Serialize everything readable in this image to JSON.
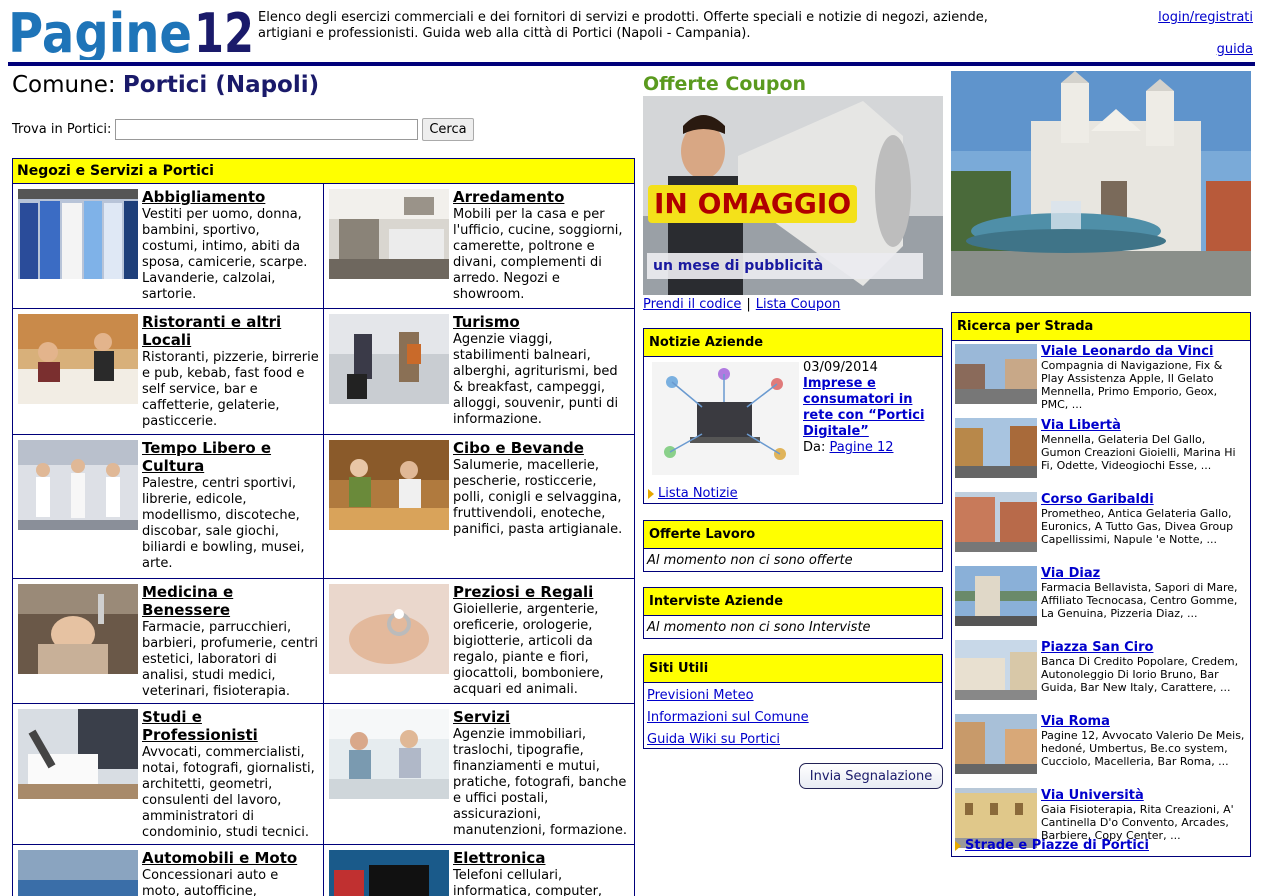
{
  "header": {
    "logo_text": "Pagine12",
    "tagline": "Elenco degli esercizi commerciali e dei fornitori di servizi e prodotti. Offerte speciali e notizie di negozi, aziende, artigiani e professionisti. Guida web alla città di Portici (Napoli - Campania).",
    "login_label": "login/registrati",
    "guide_label": "guida"
  },
  "comune": {
    "label": "Comune:",
    "name": "Portici (Napoli)"
  },
  "search": {
    "label": "Trova in Portici:",
    "value": "",
    "button": "Cerca"
  },
  "categories": {
    "title": "Negozi e Servizi a Portici",
    "items": [
      {
        "title": "Abbigliamento",
        "desc": "Vestiti per uomo, donna, bambini, sportivo, costumi, intimo, abiti da sposa, camicerie, scarpe. Lavanderie, calzolai, sartorie."
      },
      {
        "title": "Arredamento",
        "desc": "Mobili per la casa e per l'ufficio, cucine, soggiorni, camerette, poltrone e divani, complementi di arredo. Negozi e showroom."
      },
      {
        "title": "Ristoranti e altri Locali",
        "desc": "Ristoranti, pizzerie, birrerie e pub, kebab, fast food e self service, bar e caffetterie, gelaterie, pasticcerie."
      },
      {
        "title": "Turismo",
        "desc": "Agenzie viaggi, stabilimenti balneari, alberghi, agriturismi, bed & breakfast, campeggi, alloggi, souvenir, punti di informazione."
      },
      {
        "title": "Tempo Libero e Cultura",
        "desc": "Palestre, centri sportivi, librerie, edicole, modellismo, discoteche, discobar, sale giochi, biliardi e bowling, musei, arte."
      },
      {
        "title": "Cibo e Bevande",
        "desc": "Salumerie, macellerie, pescherie, rosticcerie, polli, conigli e selvaggina, fruttivendoli, enoteche, panifici, pasta artigianale."
      },
      {
        "title": "Medicina e Benessere",
        "desc": "Farmacie, parrucchieri, barbieri, profumerie, centri estetici, laboratori di analisi, studi medici, veterinari, fisioterapia."
      },
      {
        "title": "Preziosi e Regali",
        "desc": "Gioiellerie, argenterie, oreficerie, orologerie, bigiotterie, articoli da regalo, piante e fiori, giocattoli, bomboniere, acquari ed animali."
      },
      {
        "title": "Studi e Professionisti",
        "desc": "Avvocati, commercialisti, notai, fotografi, giornalisti, architetti, geometri, consulenti del lavoro, amministratori di condominio, studi tecnici."
      },
      {
        "title": "Servizi",
        "desc": "Agenzie immobiliari, traslochi, tipografie, finanziamenti e mutui, pratiche, fotografi, banche e uffici postali, assicurazioni, manutenzioni, formazione."
      },
      {
        "title": "Automobili e Moto",
        "desc": "Concessionari auto e moto, autofficine,"
      },
      {
        "title": "Elettronica",
        "desc": "Telefoni cellulari, informatica, computer,"
      }
    ]
  },
  "coupon": {
    "title": "Offerte Coupon",
    "banner_big": "IN OMAGGIO",
    "banner_small": "un mese di pubblicità",
    "link_code": "Prendi il codice",
    "link_list": "Lista Coupon"
  },
  "news": {
    "title": "Notizie Aziende",
    "date": "03/09/2014",
    "headline": "Imprese e consumatori in rete con “Portici Digitale”",
    "from_label": "Da:",
    "from_link": "Pagine 12",
    "more": "Lista Notizie"
  },
  "jobs": {
    "title": "Offerte Lavoro",
    "empty": "Al momento non ci sono offerte"
  },
  "interviews": {
    "title": "Interviste Aziende",
    "empty": "Al momento non ci sono Interviste"
  },
  "sites": {
    "title": "Siti Utili",
    "links": [
      "Previsioni Meteo",
      "Informazioni sul Comune",
      "Guida Wiki su Portici"
    ]
  },
  "report_button": "Invia Segnalazione",
  "streets": {
    "title": "Ricerca per Strada",
    "items": [
      {
        "name": "Viale Leonardo da Vinci",
        "desc": "Compagnia di Navigazione, Fix & Play Assistenza Apple, Il Gelato Mennella, Primo Emporio, Geox, PMC, ..."
      },
      {
        "name": "Via Libertà",
        "desc": "Mennella, Gelateria Del Gallo, Gumon Creazioni Gioielli, Marina Hi Fi, Odette, Videogiochi Esse, ..."
      },
      {
        "name": "Corso Garibaldi",
        "desc": "Prometheo, Antica Gelateria Gallo, Euronics, A Tutto Gas, Divea Group Capellissimi, Napule 'e Notte, ..."
      },
      {
        "name": "Via Diaz",
        "desc": "Farmacia Bellavista, Sapori di Mare, Affiliato Tecnocasa, Centro Gomme, La Genuina, Pizzeria Diaz, ..."
      },
      {
        "name": "Piazza San Ciro",
        "desc": "Banca Di Credito Popolare, Credem, Autonoleggio Di Iorio Bruno, Bar Guida, Bar New Italy, Carattere, ..."
      },
      {
        "name": "Via Roma",
        "desc": "Pagine 12, Avvocato Valerio De Meis, hedoné, Umbertus, Be.co system, Cucciolo, Macelleria, Bar Roma, ..."
      },
      {
        "name": "Via Università",
        "desc": "Gaia Fisioterapia, Rita Creazioni, A' Cantinella D'o Convento, Arcades, Barbiere, Copy Center, ..."
      }
    ],
    "more": "Strade e Piazze di Portici"
  }
}
